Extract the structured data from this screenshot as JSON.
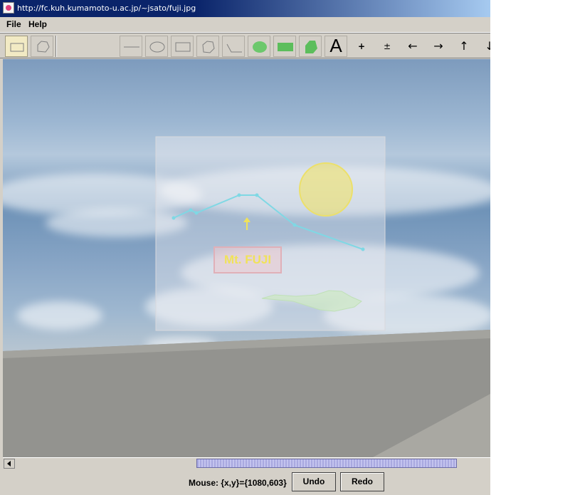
{
  "window": {
    "title": "http://fc.kuh.kumamoto-u.ac.jp/~jsato/fuji.jpg"
  },
  "menu": [
    {
      "label": "File"
    },
    {
      "label": "Help"
    }
  ],
  "toolbar": {
    "tools": [
      {
        "name": "select-rect-tool",
        "icon": "rectangle-selection-icon",
        "selected": true
      },
      {
        "name": "select-freeform-tool",
        "icon": "freeform-selection-icon"
      },
      {
        "name": "line-tool",
        "icon": "line-icon"
      },
      {
        "name": "ellipse-tool",
        "icon": "ellipse-outline-icon"
      },
      {
        "name": "rectangle-tool",
        "icon": "rectangle-outline-icon"
      },
      {
        "name": "polygon-tool",
        "icon": "polygon-outline-icon"
      },
      {
        "name": "polyline-tool",
        "icon": "polyline-icon"
      },
      {
        "name": "filled-ellipse-tool",
        "icon": "filled-ellipse-icon"
      },
      {
        "name": "filled-rectangle-tool",
        "icon": "filled-rectangle-icon"
      },
      {
        "name": "filled-polygon-tool",
        "icon": "filled-polygon-icon"
      }
    ],
    "text_tool": "A",
    "zoom_in": "+",
    "zoom_out": "±",
    "arrow_left": "←",
    "arrow_right": "→",
    "arrow_up": "↑",
    "arrow_down": "↓"
  },
  "canvas": {
    "annotation_label": "Mt. FUJI",
    "colors": {
      "polyline": "#7fd8e4",
      "sun": "#f0e26a",
      "arrow": "#f0e25a",
      "label_border": "#e0b0b8",
      "plane": "#cfe8c8"
    }
  },
  "status": {
    "mouse": "Mouse: {x,y}={1080,603}",
    "undo": "Undo",
    "redo": "Redo"
  }
}
